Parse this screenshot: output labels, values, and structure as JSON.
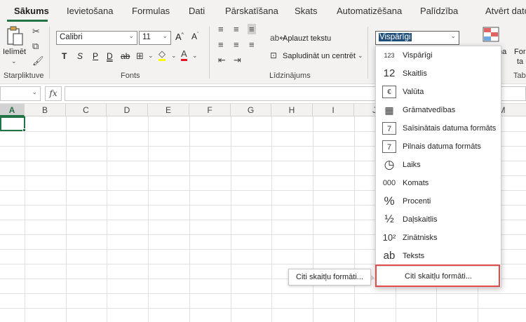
{
  "tabs": [
    {
      "label": "Sākums",
      "active": true
    },
    {
      "label": "Ievietošana"
    },
    {
      "label": "Formulas"
    },
    {
      "label": "Dati"
    },
    {
      "label": "Pārskatīšana"
    },
    {
      "label": "Skats"
    },
    {
      "label": "Automatizēšana"
    },
    {
      "label": "Palīdzība"
    },
    {
      "label": "Atvērt dato"
    }
  ],
  "accent_color": "#217346",
  "highlight_color": "#e04b4b",
  "ribbon": {
    "clipboard": {
      "paste_label": "Ielīmēt",
      "group_label": "Starpliktuve"
    },
    "font": {
      "font_name": "Calibri",
      "font_size": "11",
      "group_label": "Fonts",
      "bold": "T",
      "italic": "S",
      "underline": "P",
      "double_underline": "D",
      "strike": "ab"
    },
    "alignment": {
      "wrap_text": "Aplauzt tekstu",
      "merge_center": "Sapludināt un centrēt",
      "group_label": "Līdzinājums"
    },
    "number": {
      "format_value": "Vispārīgi"
    },
    "right_partial": {
      "label1": "ma",
      "label2": "For",
      "label3": "ta",
      "label4": "Tab"
    }
  },
  "formula_bar": {
    "fx": "fx"
  },
  "columns": [
    "A",
    "B",
    "C",
    "D",
    "E",
    "F",
    "G",
    "H",
    "I",
    "J",
    "K",
    "L",
    "M"
  ],
  "number_formats": [
    {
      "label": "Vispārīgi",
      "icon": "123"
    },
    {
      "label": "Skaitlis",
      "icon": "12"
    },
    {
      "label": "Valūta",
      "icon": "€"
    },
    {
      "label": "Grāmatvedības",
      "icon": "▦"
    },
    {
      "label": "Saīsinātais datuma formāts",
      "icon": "7"
    },
    {
      "label": "Pilnais datuma formāts",
      "icon": "7"
    },
    {
      "label": "Laiks",
      "icon": "◷"
    },
    {
      "label": "Komats",
      "icon": "000"
    },
    {
      "label": "Procenti",
      "icon": "%"
    },
    {
      "label": "Daļskaitlis",
      "icon": "½"
    },
    {
      "label": "Zinātnisks",
      "icon": "10²"
    },
    {
      "label": "Teksts",
      "icon": "ab"
    }
  ],
  "more_formats_label": "Citi skaitļu formāti...",
  "tooltip_label": "Citi skaitļu formāti..."
}
